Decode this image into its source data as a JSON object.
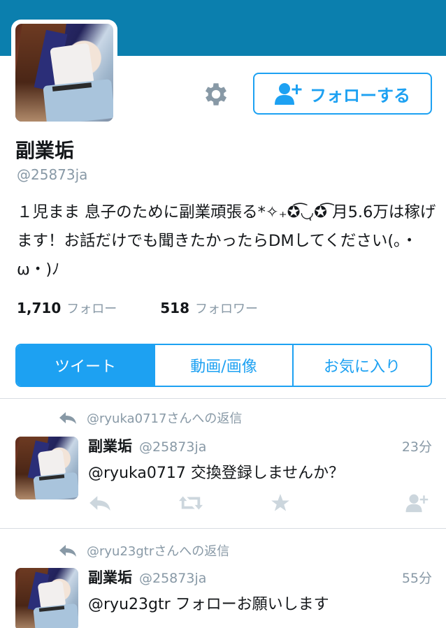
{
  "profile": {
    "display_name": "副業垢",
    "screen_name": "@25873ja",
    "bio": "１児まま 息子のために副業頑張る*✧₊✪͡◡ͅ✪͡ 月5.6万は稼げます！お話だけでも聞きたかったらDMしてください(｡・ω・)ﾉ",
    "following_count": "1,710",
    "following_label": "フォロー",
    "followers_count": "518",
    "followers_label": "フォロワー",
    "follow_button_label": "フォローする"
  },
  "tabs": [
    {
      "label": "ツイート",
      "active": true
    },
    {
      "label": "動画/画像",
      "active": false
    },
    {
      "label": "お気に入り",
      "active": false
    }
  ],
  "tweets": [
    {
      "reply_to": "@ryuka0717さんへの返信",
      "name": "副業垢",
      "handle": "@25873ja",
      "time": "23分",
      "text": "@ryuka0717 交換登録しませんか？"
    },
    {
      "reply_to": "@ryu23gtrさんへの返信",
      "name": "副業垢",
      "handle": "@25873ja",
      "time": "55分",
      "text": "@ryu23gtr フォローお願いします"
    }
  ],
  "icons": {
    "settings": "gear-icon",
    "follow": "add-user-icon",
    "reply": "reply-icon",
    "retweet": "retweet-icon",
    "favorite": "star-icon",
    "follow_small": "add-user-icon"
  },
  "colors": {
    "banner": "#0b7fae",
    "accent": "#1da1f2",
    "muted": "#8899a6",
    "icon_gray": "#ccd6dd"
  }
}
